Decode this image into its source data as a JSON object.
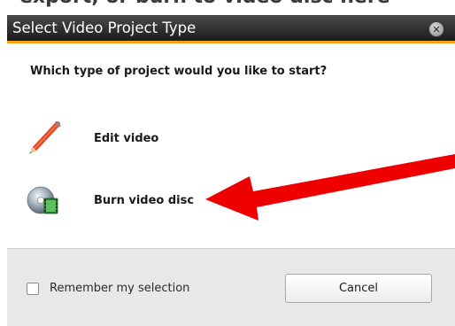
{
  "background": {
    "partial_text": "export, or burn to video disc here"
  },
  "dialog": {
    "title": "Select Video Project Type",
    "close_icon": "close-icon",
    "question": "Which type of project would you like to start?",
    "options": [
      {
        "label": "Edit video",
        "icon": "pencil-icon"
      },
      {
        "label": "Burn video disc",
        "icon": "video-disc-icon"
      }
    ],
    "remember_label": "Remember my selection",
    "remember_checked": false,
    "cancel_label": "Cancel"
  },
  "colors": {
    "title_bar": "#2b2b2b",
    "title_accent": "#f7a117",
    "footer": "#e8e8e8",
    "annotation_arrow": "#ee0000"
  }
}
